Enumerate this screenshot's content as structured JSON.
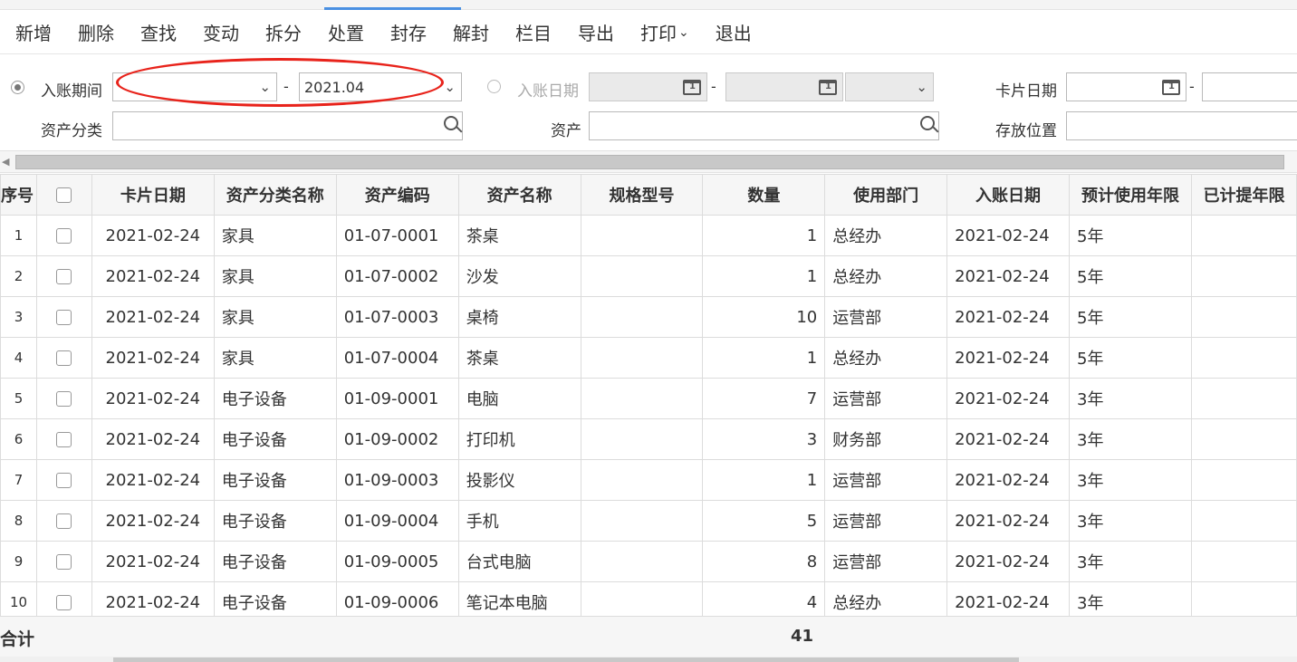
{
  "toolbar": {
    "items": [
      "新增",
      "删除",
      "查找",
      "变动",
      "拆分",
      "处置",
      "封存",
      "解封",
      "栏目",
      "导出",
      "打印",
      "退出"
    ],
    "caret": "⌄"
  },
  "filters": {
    "period_label": "入账期间",
    "period_end": "2021.04",
    "date_label": "入账日期",
    "card_date_label": "卡片日期",
    "category_label": "资产分类",
    "asset_label": "资产",
    "location_label": "存放位置",
    "dash": "-"
  },
  "table": {
    "headers": [
      "序号",
      "",
      "卡片日期",
      "资产分类名称",
      "资产编码",
      "资产名称",
      "规格型号",
      "数量",
      "使用部门",
      "入账日期",
      "预计使用年限",
      "已计提年限"
    ],
    "rows": [
      {
        "seq": "1",
        "card_date": "2021-02-24",
        "category": "家具",
        "code": "01-07-0001",
        "name": "茶桌",
        "spec": "",
        "qty": "1",
        "dept": "总经办",
        "entry_date": "2021-02-24",
        "life": "5年",
        "accrued": ""
      },
      {
        "seq": "2",
        "card_date": "2021-02-24",
        "category": "家具",
        "code": "01-07-0002",
        "name": "沙发",
        "spec": "",
        "qty": "1",
        "dept": "总经办",
        "entry_date": "2021-02-24",
        "life": "5年",
        "accrued": ""
      },
      {
        "seq": "3",
        "card_date": "2021-02-24",
        "category": "家具",
        "code": "01-07-0003",
        "name": "桌椅",
        "spec": "",
        "qty": "10",
        "dept": "运营部",
        "entry_date": "2021-02-24",
        "life": "5年",
        "accrued": ""
      },
      {
        "seq": "4",
        "card_date": "2021-02-24",
        "category": "家具",
        "code": "01-07-0004",
        "name": "茶桌",
        "spec": "",
        "qty": "1",
        "dept": "总经办",
        "entry_date": "2021-02-24",
        "life": "5年",
        "accrued": ""
      },
      {
        "seq": "5",
        "card_date": "2021-02-24",
        "category": "电子设备",
        "code": "01-09-0001",
        "name": "电脑",
        "spec": "",
        "qty": "7",
        "dept": "运营部",
        "entry_date": "2021-02-24",
        "life": "3年",
        "accrued": ""
      },
      {
        "seq": "6",
        "card_date": "2021-02-24",
        "category": "电子设备",
        "code": "01-09-0002",
        "name": "打印机",
        "spec": "",
        "qty": "3",
        "dept": "财务部",
        "entry_date": "2021-02-24",
        "life": "3年",
        "accrued": ""
      },
      {
        "seq": "7",
        "card_date": "2021-02-24",
        "category": "电子设备",
        "code": "01-09-0003",
        "name": "投影仪",
        "spec": "",
        "qty": "1",
        "dept": "运营部",
        "entry_date": "2021-02-24",
        "life": "3年",
        "accrued": ""
      },
      {
        "seq": "8",
        "card_date": "2021-02-24",
        "category": "电子设备",
        "code": "01-09-0004",
        "name": "手机",
        "spec": "",
        "qty": "5",
        "dept": "运营部",
        "entry_date": "2021-02-24",
        "life": "3年",
        "accrued": ""
      },
      {
        "seq": "9",
        "card_date": "2021-02-24",
        "category": "电子设备",
        "code": "01-09-0005",
        "name": "台式电脑",
        "spec": "",
        "qty": "8",
        "dept": "运营部",
        "entry_date": "2021-02-24",
        "life": "3年",
        "accrued": ""
      },
      {
        "seq": "10",
        "card_date": "2021-02-24",
        "category": "电子设备",
        "code": "01-09-0006",
        "name": "笔记本电脑",
        "spec": "",
        "qty": "4",
        "dept": "总经办",
        "entry_date": "2021-02-24",
        "life": "3年",
        "accrued": ""
      }
    ]
  },
  "totals": {
    "label": "合计",
    "qty": "41"
  },
  "colors": {
    "highlight_oval": "#e8231b",
    "active_tab": "#4a90e2"
  }
}
